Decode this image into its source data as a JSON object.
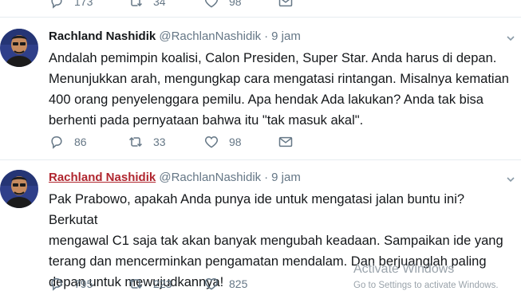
{
  "top_actions": {
    "replies": "173",
    "retweets": "34",
    "likes": "98"
  },
  "tweets": [
    {
      "name": "Rachland Nashidik",
      "handle": "@RachlanNashidik",
      "dot": "·",
      "time": "9 jam",
      "text": "Andalah pemimpin koalisi, Calon Presiden, Super Star. Anda harus di depan.\nMenunjukkan arah, mengungkap cara mengatasi rintangan. Misalnya kematian\n400 orang penyelenggara pemilu. Apa hendak Ada lakukan? Anda tak bisa\nberhenti pada pernyataan bahwa itu \"tak masuk akal\".",
      "replies": "86",
      "retweets": "33",
      "likes": "98"
    },
    {
      "name": "Rachland Nashidik",
      "handle": "@RachlanNashidik",
      "dot": "·",
      "time": "9 jam",
      "text": "Pak Prabowo, apakah Anda punya ide untuk mengatasi jalan buntu ini? Berkutat\nmengawal C1 saja tak akan banyak mengubah keadaan. Sampaikan ide yang\nterang dan mencerminkan pengamatan mendalam. Dan berjuanglah paling\ndepan untuk mewujudkannya!",
      "replies": "795",
      "retweets": "223",
      "likes": "825"
    }
  ],
  "watermark": {
    "title": "Activate Windows",
    "subtitle": "Go to Settings to activate Windows."
  },
  "colors": {
    "icon": "#657786",
    "name": "#14171a",
    "name_hover": "#b0262f",
    "divider": "#e6ecf0"
  }
}
